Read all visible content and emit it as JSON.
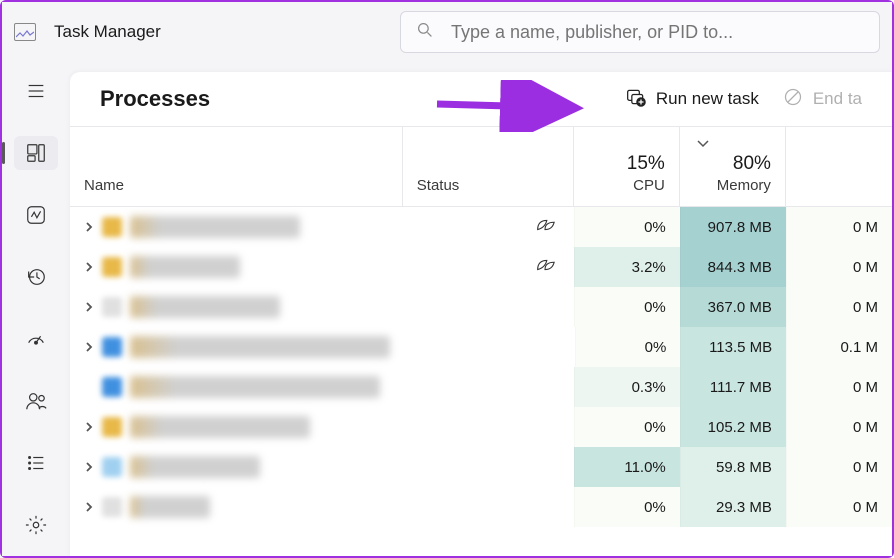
{
  "app": {
    "title": "Task Manager"
  },
  "search": {
    "placeholder": "Type a name, publisher, or PID to..."
  },
  "sidebar": {
    "items": [
      {
        "name": "menu"
      },
      {
        "name": "processes",
        "active": true
      },
      {
        "name": "performance"
      },
      {
        "name": "app-history"
      },
      {
        "name": "startup"
      },
      {
        "name": "users"
      },
      {
        "name": "details"
      },
      {
        "name": "settings"
      }
    ]
  },
  "panel": {
    "title": "Processes",
    "run_new_task": "Run new task",
    "end_task": "End ta"
  },
  "columns": {
    "name": "Name",
    "status": "Status",
    "cpu": {
      "pct": "15%",
      "label": "CPU"
    },
    "memory": {
      "pct": "80%",
      "label": "Memory",
      "sorted": true
    },
    "disk": {
      "pct": "",
      "label": ""
    }
  },
  "rows": [
    {
      "expand": true,
      "leaf": true,
      "cpu": "0%",
      "cpu_h": 0,
      "mem": "907.8 MB",
      "mem_h": 5,
      "disk": "0 M",
      "disk_h": 0
    },
    {
      "expand": true,
      "leaf": true,
      "cpu": "3.2%",
      "cpu_h": 2,
      "mem": "844.3 MB",
      "mem_h": 5,
      "disk": "0 M",
      "disk_h": 0
    },
    {
      "expand": true,
      "leaf": false,
      "cpu": "0%",
      "cpu_h": 0,
      "mem": "367.0 MB",
      "mem_h": 4,
      "disk": "0 M",
      "disk_h": 0
    },
    {
      "expand": true,
      "leaf": false,
      "cpu": "0%",
      "cpu_h": 0,
      "mem": "113.5 MB",
      "mem_h": 3,
      "disk": "0.1 M",
      "disk_h": 0
    },
    {
      "expand": false,
      "leaf": false,
      "cpu": "0.3%",
      "cpu_h": 1,
      "mem": "111.7 MB",
      "mem_h": 3,
      "disk": "0 M",
      "disk_h": 0
    },
    {
      "expand": true,
      "leaf": false,
      "cpu": "0%",
      "cpu_h": 0,
      "mem": "105.2 MB",
      "mem_h": 3,
      "disk": "0 M",
      "disk_h": 0
    },
    {
      "expand": true,
      "leaf": false,
      "cpu": "11.0%",
      "cpu_h": 3,
      "mem": "59.8 MB",
      "mem_h": 2,
      "disk": "0 M",
      "disk_h": 0
    },
    {
      "expand": true,
      "leaf": false,
      "cpu": "0%",
      "cpu_h": 0,
      "mem": "29.3 MB",
      "mem_h": 2,
      "disk": "0 M",
      "disk_h": 0
    }
  ]
}
